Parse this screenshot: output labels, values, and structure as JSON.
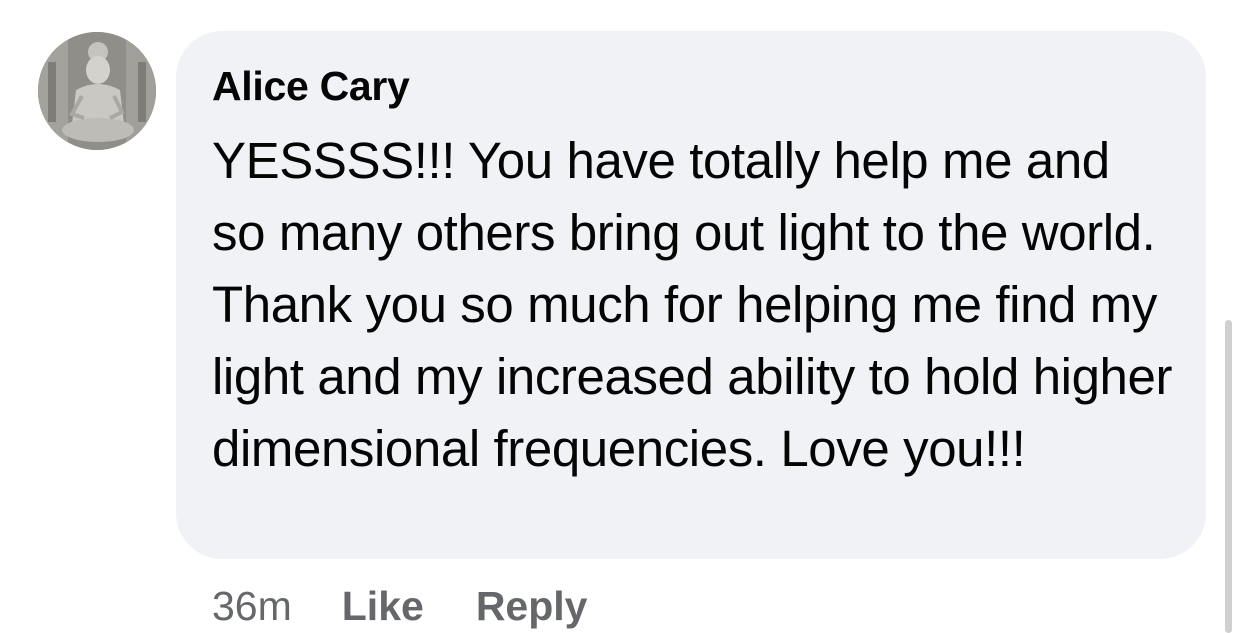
{
  "comment": {
    "avatar_icon": "buddha-statue-avatar",
    "author": "Alice Cary",
    "text": "YESSSS!!! You have totally help me and so many others bring out light to the world. Thank you so much for helping me find my light and my increased ability to hold higher dimensional frequencies. Love you!!!",
    "timestamp": "36m",
    "like_label": "Like",
    "reply_label": "Reply"
  },
  "colors": {
    "bubble_bg": "#f0f2f5",
    "text": "#050505",
    "secondary_text": "#65676b"
  }
}
